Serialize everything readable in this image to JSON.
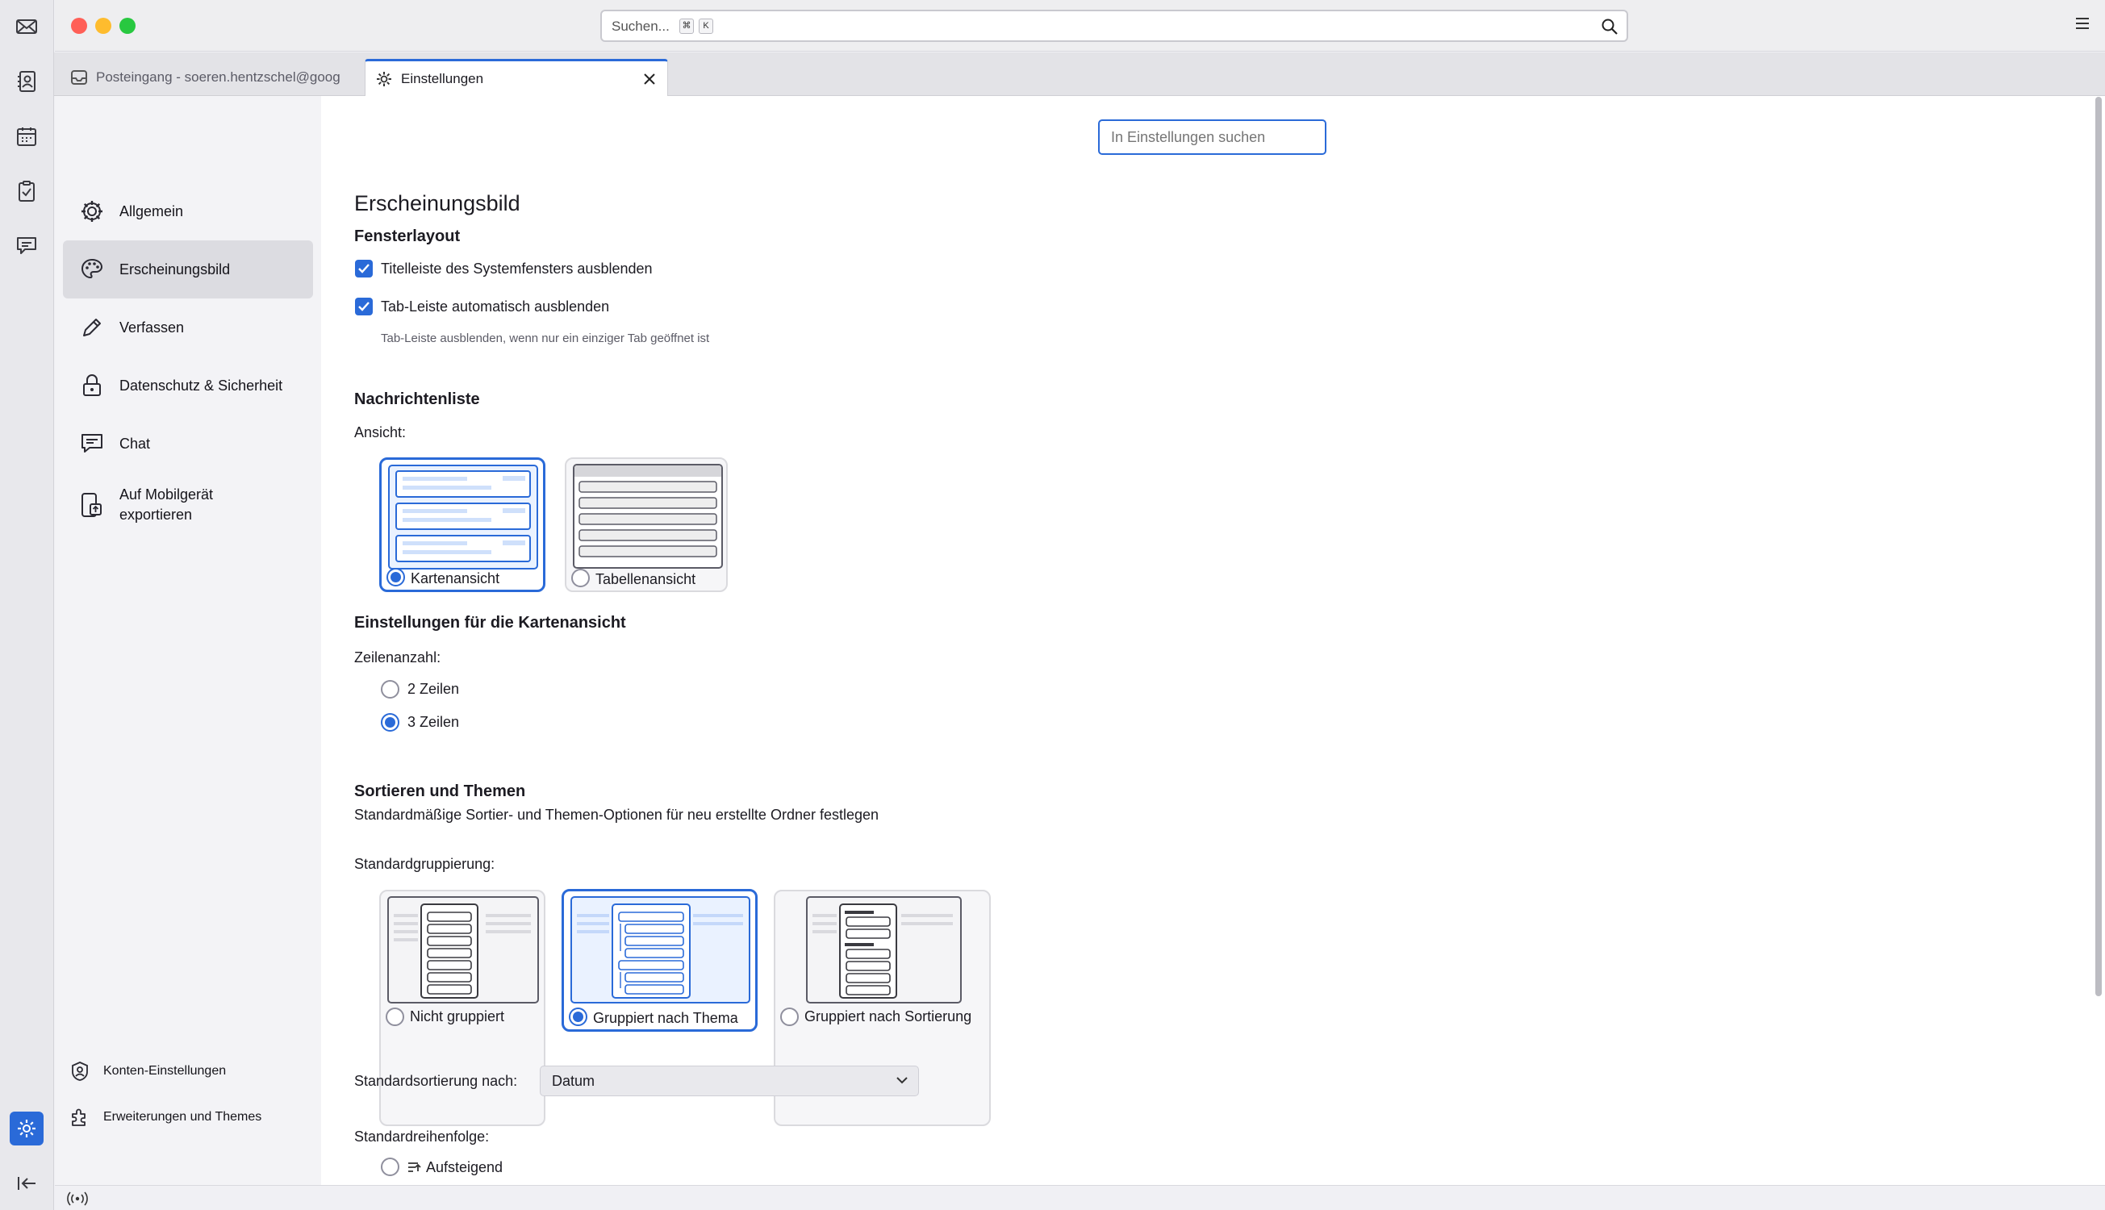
{
  "titlebar": {
    "search_placeholder": "Suchen...",
    "shortcut_keys": [
      "⌘",
      "K"
    ],
    "colors": {
      "close": "#ff5f57",
      "minimize": "#febc2e",
      "maximize": "#28c840"
    }
  },
  "tabs": [
    {
      "label": "Posteingang - soeren.hentzschel@goog",
      "icon": "inbox-icon"
    },
    {
      "label": "Einstellungen",
      "icon": "gear-icon"
    }
  ],
  "settings_search": {
    "placeholder": "In Einstellungen suchen"
  },
  "sidebar": {
    "items": [
      {
        "label": "Allgemein",
        "icon": "gear-icon"
      },
      {
        "label": "Erscheinungsbild",
        "icon": "palette-icon",
        "selected": true
      },
      {
        "label": "Verfassen",
        "icon": "pencil-icon"
      },
      {
        "label": "Datenschutz & Sicherheit",
        "icon": "lock-icon"
      },
      {
        "label": "Chat",
        "icon": "chat-icon"
      },
      {
        "label_line1": "Auf Mobilgerät",
        "label_line2": "exportieren",
        "icon": "mobile-export-icon"
      }
    ],
    "bottom": [
      {
        "label": "Konten-Einstellungen",
        "icon": "account-icon"
      },
      {
        "label": "Erweiterungen und Themes",
        "icon": "puzzle-icon"
      }
    ]
  },
  "content": {
    "page_title": "Erscheinungsbild",
    "window_layout": {
      "heading": "Fensterlayout",
      "hide_titlebar": {
        "label": "Titelleiste des Systemfensters ausblenden",
        "checked": true
      },
      "autohide_tabbar": {
        "label": "Tab-Leiste automatisch ausblenden",
        "checked": true
      },
      "autohide_hint": "Tab-Leiste ausblenden, wenn nur ein einziger Tab geöffnet ist"
    },
    "message_list": {
      "heading": "Nachrichtenliste",
      "view_label": "Ansicht:",
      "views": [
        {
          "label": "Kartenansicht",
          "selected": true
        },
        {
          "label": "Tabellenansicht",
          "selected": false
        }
      ]
    },
    "card_settings": {
      "heading": "Einstellungen für die Kartenansicht",
      "rows_label": "Zeilenanzahl:",
      "options": [
        {
          "label": "2 Zeilen",
          "selected": false
        },
        {
          "label": "3 Zeilen",
          "selected": true
        }
      ]
    },
    "sorting": {
      "heading": "Sortieren und Themen",
      "description": "Standardmäßige Sortier- und Themen-Optionen für neu erstellte Ordner festlegen",
      "grouping_label": "Standardgruppierung:",
      "groupings": [
        {
          "label": "Nicht gruppiert",
          "selected": false
        },
        {
          "label": "Gruppiert nach Thema",
          "selected": true
        },
        {
          "label": "Gruppiert nach Sortierung",
          "selected": false
        }
      ],
      "sort_by_label": "Standardsortierung nach:",
      "sort_by_value": "Datum",
      "order_label": "Standardreihenfolge:",
      "order_option": {
        "label": "Aufsteigend",
        "selected": false
      }
    }
  },
  "accent_color": "#2a6ad8"
}
